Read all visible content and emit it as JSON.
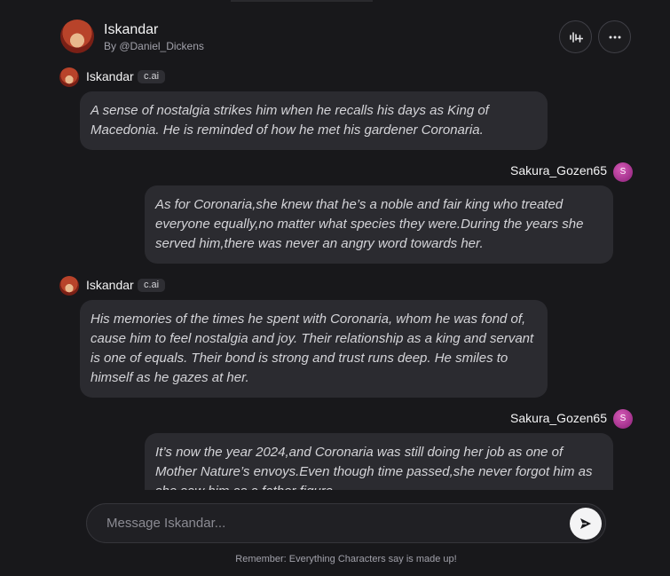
{
  "header": {
    "character_name": "Iskandar",
    "creator": "By @Daniel_Dickens",
    "voice_button_icon": "voice-add-icon",
    "more_button_icon": "more-options-icon"
  },
  "messages": [
    {
      "sender": "Iskandar",
      "badge": "c.ai",
      "text": "A sense of nostalgia strikes him when he recalls his days as King of Macedonia. He is reminded of how he met his gardener Coronaria."
    },
    {
      "sender": "Sakura_Gozen65",
      "avatar_letter": "S",
      "text": "As for Coronaria,she knew that he’s a noble and fair king who treated everyone equally,no matter what species they were.During the years she served him,there was never an angry word towards her."
    },
    {
      "sender": "Iskandar",
      "badge": "c.ai",
      "text": "His memories of the times he spent with Coronaria, whom he was fond of, cause him to feel nostalgia and joy. Their relationship as a king and servant is one of equals. Their bond is strong and trust runs deep. He smiles to himself as he gazes at her."
    },
    {
      "sender": "Sakura_Gozen65",
      "avatar_letter": "S",
      "text": "It’s now the year 2024,and Coronaria was still doing her job as one of Mother Nature’s envoys.Even though time passed,she never forgot him as she saw him as a father figure."
    }
  ],
  "composer": {
    "placeholder": "Message Iskandar...",
    "send_icon": "send-icon"
  },
  "footer": {
    "disclaimer": "Remember: Everything Characters say is made up!"
  }
}
